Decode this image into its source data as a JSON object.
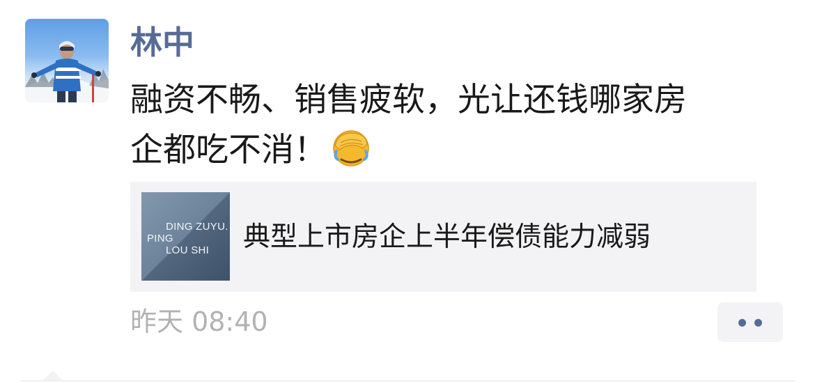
{
  "post": {
    "author": "林中",
    "text_lines": [
      "融资不畅、销售疲软，光让还钱哪家房",
      "企都吃不消！"
    ],
    "emoji": "facepalm-emoji",
    "time": "昨天 08:40"
  },
  "link_card": {
    "thumb_lines": [
      "DING ZUYU.",
      "PING",
      "LOU SHI"
    ],
    "title": "典型上市房企上半年偿债能力减弱"
  },
  "colors": {
    "name": "#576b95",
    "text": "#191919",
    "time": "#b2b2b2",
    "card_bg": "#f3f3f5"
  }
}
